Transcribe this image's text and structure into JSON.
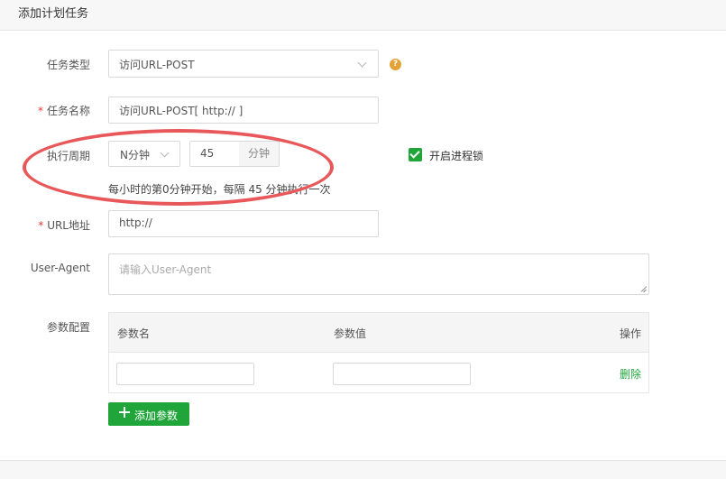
{
  "header": {
    "title": "添加计划任务"
  },
  "form": {
    "task_type": {
      "label": "任务类型",
      "value": "访问URL-POST"
    },
    "task_name": {
      "required_mark": "*",
      "label": "任务名称",
      "value": "访问URL-POST[ http:// ]"
    },
    "cycle": {
      "label": "执行周期",
      "period_value": "N分钟",
      "minutes_value": "45",
      "minutes_unit": "分钟",
      "hint": "每小时的第0分钟开始，每隔 45 分钟执行一次"
    },
    "process_lock": {
      "label": "开启进程锁",
      "checked": true
    },
    "url": {
      "required_mark": "*",
      "label": "URL地址",
      "value": "http://"
    },
    "user_agent": {
      "label": "User-Agent",
      "placeholder": "请输入User-Agent"
    },
    "params": {
      "label": "参数配置",
      "columns": [
        "参数名",
        "参数值",
        "操作"
      ],
      "rows": [
        {
          "name": "",
          "value": "",
          "action": "删除"
        }
      ],
      "add_button": "添加参数"
    }
  },
  "colors": {
    "primary": "#20a53a",
    "required": "#e4393c",
    "help": "#e3a33a",
    "annotation": "#e8585a"
  }
}
